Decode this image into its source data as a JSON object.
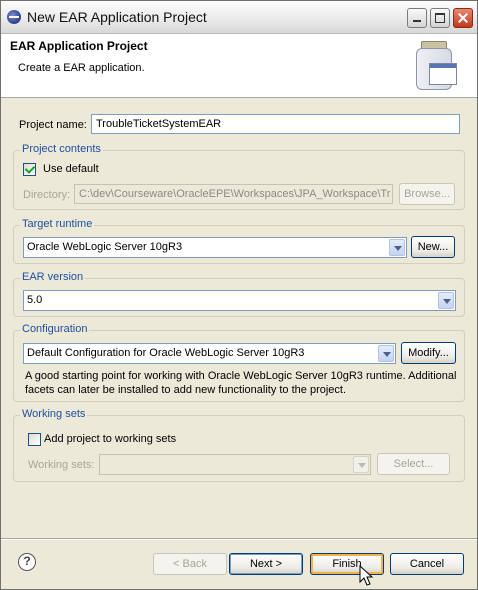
{
  "window": {
    "title": "New EAR Application Project",
    "buttons": [
      "minimize-icon",
      "maximize-icon",
      "close-icon"
    ]
  },
  "header": {
    "title": "EAR Application Project",
    "description": "Create a EAR application.",
    "banner_icon": "jar-with-window-icon"
  },
  "project_name": {
    "label": "Project name:",
    "value": "TroubleTicketSystemEAR"
  },
  "project_contents": {
    "legend": "Project contents",
    "use_default_label": "Use default",
    "use_default_checked": true,
    "directory_label": "Directory:",
    "directory_value": "C:\\dev\\Courseware\\OracleEPE\\Workspaces\\JPA_Workspace\\Tr",
    "browse_label": "Browse..."
  },
  "target_runtime": {
    "legend": "Target runtime",
    "selected": "Oracle WebLogic Server 10gR3",
    "new_label": "New..."
  },
  "ear_version": {
    "legend": "EAR version",
    "selected": "5.0"
  },
  "configuration": {
    "legend": "Configuration",
    "selected": "Default Configuration for Oracle WebLogic Server 10gR3",
    "modify_label": "Modify...",
    "description_line1": "A good starting point for working with Oracle WebLogic Server 10gR3 runtime. Additional",
    "description_line2": "facets can later be installed to add new functionality to the project."
  },
  "working_sets": {
    "legend": "Working sets",
    "add_label": "Add project to working sets",
    "add_checked": false,
    "sets_label": "Working sets:",
    "sets_value": "",
    "select_label": "Select..."
  },
  "footer": {
    "help_glyph": "?",
    "back_label": "< Back",
    "next_label": "Next >",
    "finish_label": "Finish",
    "cancel_label": "Cancel"
  },
  "colors": {
    "dialog_bg": "#ece9d8",
    "group_legend": "#1f4fa0",
    "focus_border": "#f5b14b"
  }
}
